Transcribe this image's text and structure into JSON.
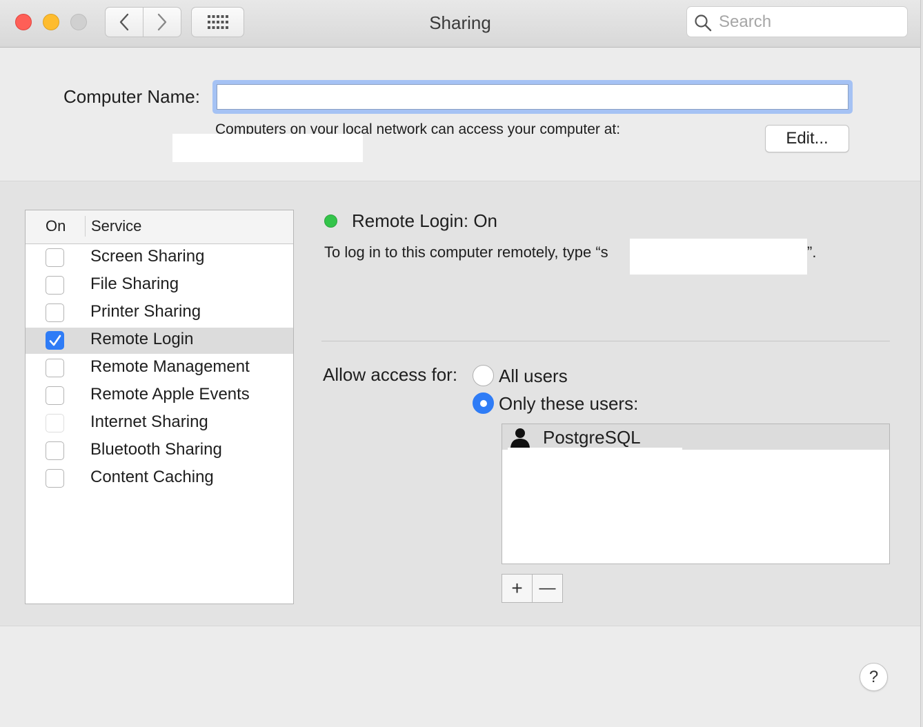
{
  "window": {
    "title": "Sharing",
    "search_placeholder": "Search"
  },
  "computer_name": {
    "label": "Computer Name:",
    "value": "",
    "hint": "Computers on your local network can access your computer at:",
    "edit_button": "Edit..."
  },
  "services_table": {
    "col_on": "On",
    "col_service": "Service",
    "rows": [
      {
        "name": "Screen Sharing",
        "checked": false
      },
      {
        "name": "File Sharing",
        "checked": false
      },
      {
        "name": "Printer Sharing",
        "checked": false
      },
      {
        "name": "Remote Login",
        "checked": true,
        "selected": true
      },
      {
        "name": "Remote Management",
        "checked": false
      },
      {
        "name": "Remote Apple Events",
        "checked": false
      },
      {
        "name": "Internet Sharing",
        "checked": false,
        "disabled": true
      },
      {
        "name": "Bluetooth Sharing",
        "checked": false
      },
      {
        "name": "Content Caching",
        "checked": false
      }
    ]
  },
  "detail": {
    "status": "Remote Login: On",
    "status_color": "#33c44a",
    "instructions_prefix": "To log in to this computer remotely, type “s",
    "instructions_suffix": "”.",
    "access_label": "Allow access for:",
    "option_all": "All users",
    "option_only": "Only these users:",
    "selected_option": "only",
    "users": [
      "PostgreSQL"
    ],
    "add_symbol": "+",
    "remove_symbol": "—"
  },
  "help_symbol": "?",
  "accent_color": "#2f7cf6"
}
